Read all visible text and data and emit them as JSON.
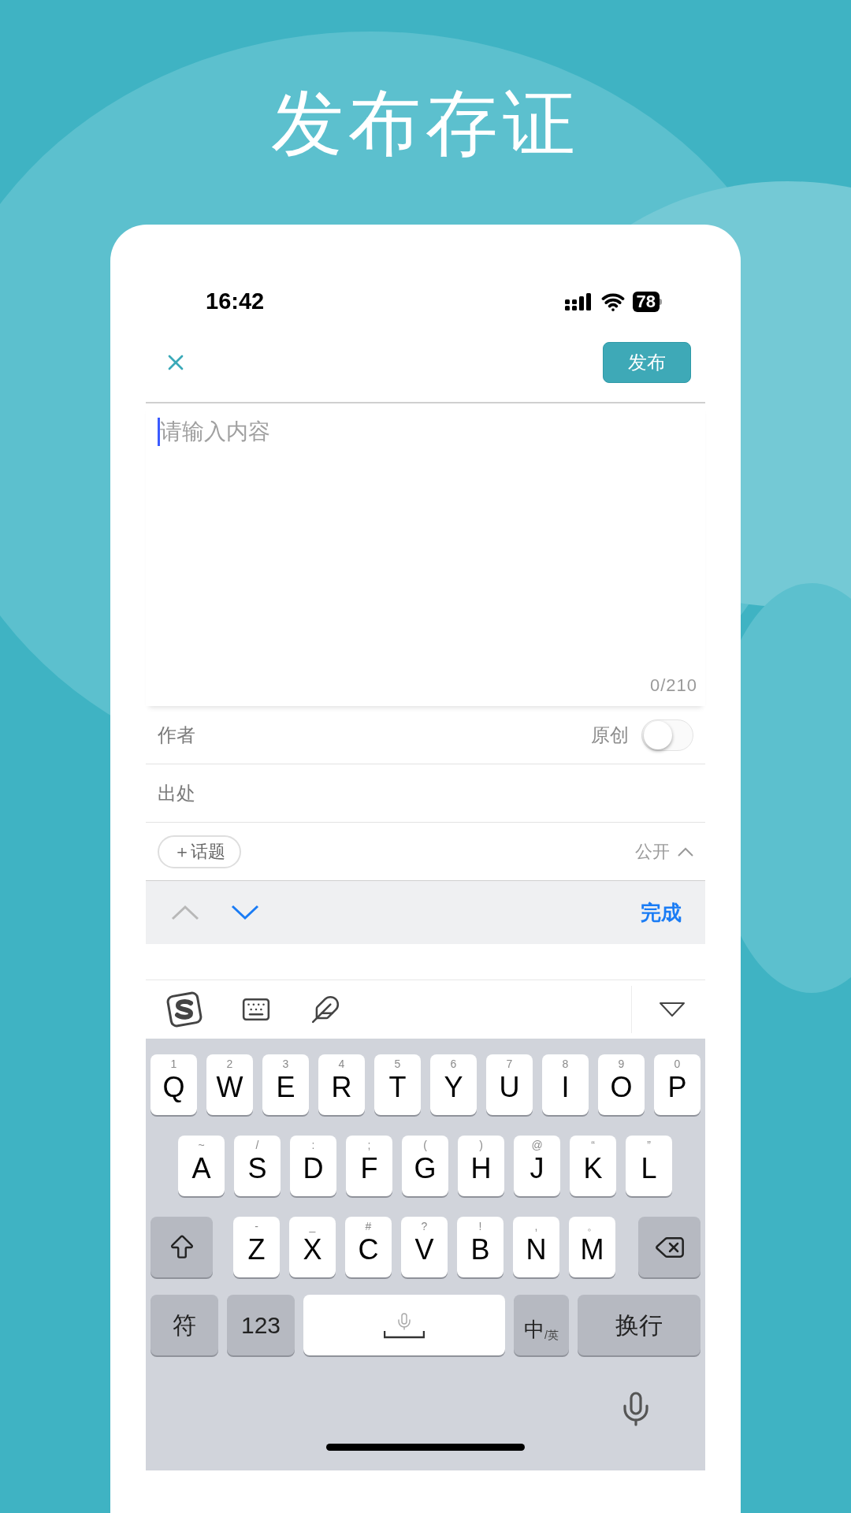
{
  "title": "发布存证",
  "status_bar": {
    "time": "16:42",
    "battery": "78"
  },
  "header": {
    "publish_button": "发布"
  },
  "editor": {
    "placeholder": "请输入内容",
    "counter": "0/210"
  },
  "fields": [
    {
      "kind": "toggle",
      "label": "作者",
      "toggle_label": "原创",
      "on": false
    },
    {
      "kind": "text",
      "label": "出处"
    },
    {
      "kind": "topic",
      "button": "＋话题",
      "visibility": "公开"
    }
  ],
  "accessory_bar": {
    "prev_disabled": true,
    "next_disabled": false,
    "done": "完成"
  },
  "keyboard": {
    "rows": [
      [
        {
          "key": "Q",
          "hint": "1"
        },
        {
          "key": "W",
          "hint": "2"
        },
        {
          "key": "E",
          "hint": "3"
        },
        {
          "key": "R",
          "hint": "4"
        },
        {
          "key": "T",
          "hint": "5"
        },
        {
          "key": "Y",
          "hint": "6"
        },
        {
          "key": "U",
          "hint": "7"
        },
        {
          "key": "I",
          "hint": "8"
        },
        {
          "key": "O",
          "hint": "9"
        },
        {
          "key": "P",
          "hint": "0"
        }
      ],
      [
        {
          "key": "A",
          "hint": "~"
        },
        {
          "key": "S",
          "hint": "/"
        },
        {
          "key": "D",
          "hint": ":"
        },
        {
          "key": "F",
          "hint": ";"
        },
        {
          "key": "G",
          "hint": "("
        },
        {
          "key": "H",
          "hint": ")"
        },
        {
          "key": "J",
          "hint": "@"
        },
        {
          "key": "K",
          "hint": "“"
        },
        {
          "key": "L",
          "hint": "”"
        }
      ],
      [
        {
          "key": "Z",
          "hint": "-"
        },
        {
          "key": "X",
          "hint": "_"
        },
        {
          "key": "C",
          "hint": "#"
        },
        {
          "key": "V",
          "hint": "?"
        },
        {
          "key": "B",
          "hint": "!"
        },
        {
          "key": "N",
          "hint": ","
        },
        {
          "key": "M",
          "hint": "。"
        }
      ]
    ],
    "symbol_key": "符",
    "number_key": "123",
    "language_key": {
      "main": "中",
      "sub": "/英"
    },
    "return_key": "换行"
  }
}
